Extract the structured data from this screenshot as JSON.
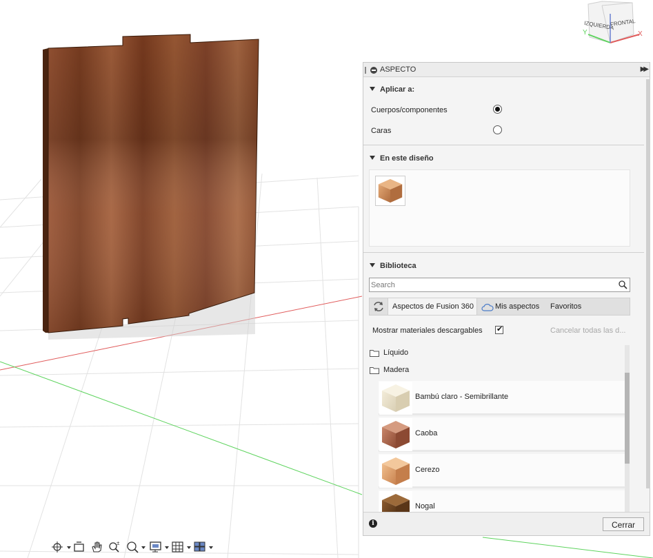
{
  "viewcube": {
    "face_left": "IZQUIERDA",
    "face_front": "FRONTAL",
    "axis_x": "X",
    "axis_y": "Y"
  },
  "panel": {
    "title": "ASPECTO",
    "apply_section": {
      "title": "Aplicar a:",
      "opt_bodies": "Cuerpos/componentes",
      "opt_faces": "Caras",
      "selected": "Cuerpos/componentes"
    },
    "design_section": {
      "title": "En este diseño",
      "swatch_icon": "wood-cube-swatch"
    },
    "library_section": {
      "title": "Biblioteca",
      "search_placeholder": "Search",
      "tab_fusion": "Aspectos de Fusion 360",
      "tab_mine": "Mis aspectos",
      "tab_favs": "Favoritos",
      "downloadable_label": "Mostrar materiales descargables",
      "downloadable_checked": true,
      "cancel_downloads": "Cancelar todas las d...",
      "folders": [
        "Líquido",
        "Madera"
      ],
      "materials": [
        "Bambú claro - Semibrillante",
        "Caoba",
        "Cerezo",
        "Nogal"
      ]
    },
    "close_label": "Cerrar"
  },
  "colors": {
    "panel_bg": "#f4f4f4",
    "axis_red": "#e05a5a",
    "axis_green": "#5cd35c",
    "wood": "#8a4a2a"
  }
}
